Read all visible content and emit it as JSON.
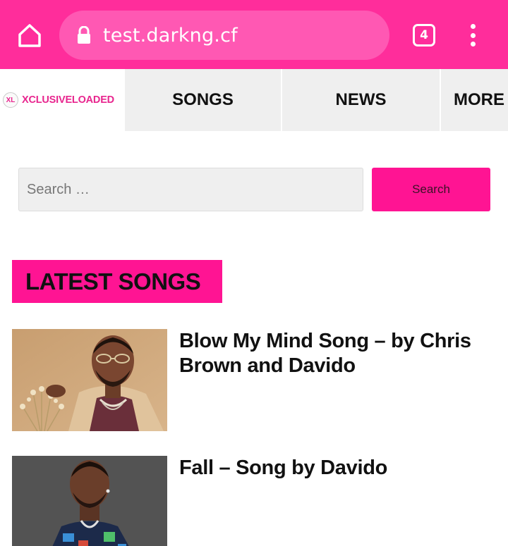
{
  "browser": {
    "url": "test.darkng.cf",
    "tab_count": "4",
    "theme_color": "#ff2d9b"
  },
  "site": {
    "logo_badge": "XL",
    "logo_text": "XCLUSIVELOADED",
    "brand_color": "#ff1493",
    "nav": [
      {
        "label": "SONGS"
      },
      {
        "label": "NEWS"
      },
      {
        "label": "MORE"
      }
    ]
  },
  "search": {
    "placeholder": "Search …",
    "button_label": "Search"
  },
  "section": {
    "title": "LATEST SONGS"
  },
  "songs": [
    {
      "title": "Blow My Mind Song – by Chris Brown and Davido"
    },
    {
      "title": "Fall – Song by Davido"
    }
  ]
}
